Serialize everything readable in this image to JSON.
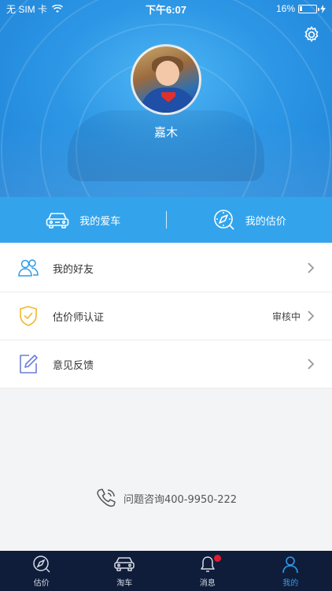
{
  "status_bar": {
    "carrier": "无 SIM 卡",
    "time": "下午6:07",
    "battery_percent_label": "16%",
    "battery_level": 0.16
  },
  "profile": {
    "username": "嘉木"
  },
  "quick_actions": [
    {
      "label": "我的爱车",
      "icon": "car-icon"
    },
    {
      "label": "我的估价",
      "icon": "valuation-compass-icon"
    }
  ],
  "menu": [
    {
      "label": "我的好友",
      "status": "",
      "icon": "friends-icon",
      "icon_color": "#2e9be8"
    },
    {
      "label": "估价师认证",
      "status": "审核中",
      "icon": "shield-check-icon",
      "icon_color": "#f0b82b"
    },
    {
      "label": "意见反馈",
      "status": "",
      "icon": "edit-feedback-icon",
      "icon_color": "#6b7fd8"
    }
  ],
  "contact": {
    "text": "问题咨询400-9950-222",
    "icon": "phone-icon"
  },
  "tabbar": [
    {
      "label": "估价",
      "icon": "compass-icon",
      "active": false,
      "badge": false
    },
    {
      "label": "淘车",
      "icon": "car-icon",
      "active": false,
      "badge": false
    },
    {
      "label": "消息",
      "icon": "bell-icon",
      "active": false,
      "badge": true
    },
    {
      "label": "我的",
      "icon": "person-icon",
      "active": true,
      "badge": false
    }
  ],
  "colors": {
    "brand_blue": "#2e9be8",
    "quick_bar": "#33a4ec",
    "tabbar_bg": "#0f1d3a",
    "badge_red": "#e41b2c"
  }
}
